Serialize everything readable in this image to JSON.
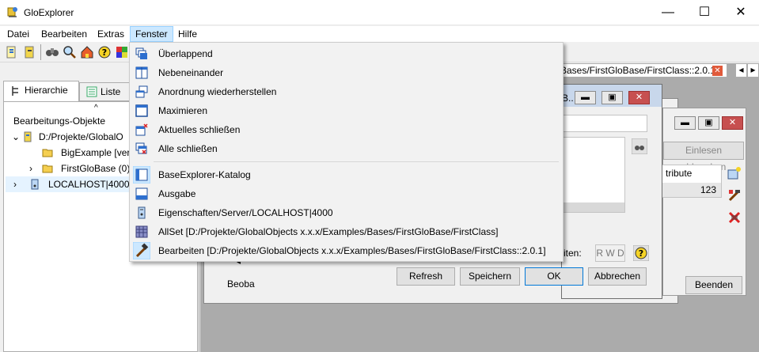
{
  "app": {
    "title": "GloExplorer"
  },
  "window_controls": {
    "minimize": "—",
    "maximize": "☐",
    "close": "✕"
  },
  "menubar": [
    {
      "label": "Datei"
    },
    {
      "label": "Bearbeiten"
    },
    {
      "label": "Extras"
    },
    {
      "label": "Fenster"
    },
    {
      "label": "Hilfe"
    }
  ],
  "left": {
    "tabs": [
      {
        "label": "Hierarchie"
      },
      {
        "label": "Liste"
      }
    ],
    "tree_header": "Bearbeitungs-Objekte",
    "tree": [
      {
        "label": "D:/Projekte/GlobalO"
      },
      {
        "label": "BigExample [ver"
      },
      {
        "label": "FirstGloBase (0)"
      },
      {
        "label": "LOCALHOST|4000"
      }
    ]
  },
  "mdi": {
    "doc_tab": "Bases/FirstGloBase/FirstClass::2.0.1]",
    "dialog_a": {
      "title_fragment": "B..",
      "buttons": {
        "refresh": "Refresh",
        "save": "Speichern",
        "ok": "OK",
        "cancel": "Abbrechen"
      },
      "rwd": "R W D",
      "rights_fragment": "iten:"
    },
    "dialog_b": {
      "read_abort": "Einlesen abbrechen",
      "col_header": "tribute",
      "cell_value": "123",
      "end": "Beenden"
    },
    "obs_fragment": "Beoba"
  },
  "fenster_menu": {
    "items": [
      {
        "label": "Überlappend",
        "icon": "cascade-icon"
      },
      {
        "label": "Nebeneinander",
        "icon": "tile-icon"
      },
      {
        "label": "Anordnung wiederherstellen",
        "icon": "restore-layout-icon"
      },
      {
        "label": "Maximieren",
        "icon": "maximize-icon"
      },
      {
        "label": "Aktuelles schließen",
        "icon": "close-window-icon"
      },
      {
        "label": "Alle schließen",
        "icon": "close-all-icon"
      },
      {
        "label": "BaseExplorer-Katalog",
        "icon": "catalog-icon"
      },
      {
        "label": "Ausgabe",
        "icon": "output-icon"
      },
      {
        "label": "Eigenschaften/Server/LOCALHOST|4000",
        "icon": "server-icon"
      },
      {
        "label": "AllSet [D:/Projekte/GlobalObjects x.x.x/Examples/Bases/FirstGloBase/FirstClass]",
        "icon": "allset-icon"
      },
      {
        "label": "Bearbeiten [D:/Projekte/GlobalObjects x.x.x/Examples/Bases/FirstGloBase/FirstClass::2.0.1]",
        "icon": "edit-hammer-icon"
      }
    ]
  },
  "colors": {
    "menu_active": "#cce8ff",
    "accent_blue": "#0078d7",
    "mdi_background": "#ababab"
  }
}
